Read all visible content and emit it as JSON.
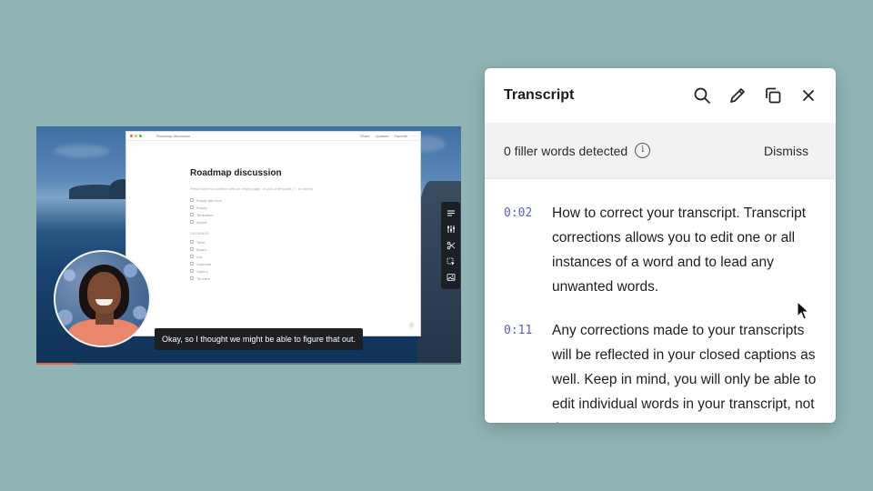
{
  "video": {
    "window": {
      "crumb": "Roadmap discussion",
      "actions": [
        "Share",
        "Updates",
        "Favorite",
        "···"
      ]
    },
    "doc": {
      "title": "Roadmap discussion",
      "hint": "Press Enter to continue with an empty page, or pick a template (↑↓ to select)",
      "options": [
        "Empty with icon",
        "Empty",
        "Templates",
        "Import"
      ],
      "section": "DATABASE",
      "database_items": [
        "Table",
        "Board",
        "List",
        "Calendar",
        "Gallery",
        "Timeline"
      ],
      "help": "?"
    },
    "toolbar_icons": [
      "lines-icon",
      "sliders-icon",
      "scissors-icon",
      "select-icon",
      "image-icon"
    ],
    "caption": "Okay, so I thought we might be able to figure that out.",
    "progress": 0.09
  },
  "transcript": {
    "title": "Transcript",
    "header_icons": [
      "search-icon",
      "pencil-icon",
      "copy-icon",
      "close-icon"
    ],
    "filler": {
      "text": "0 filler words detected",
      "info_icon": "i",
      "dismiss_label": "Dismiss"
    },
    "entries": [
      {
        "time": "0:02",
        "text": "How to correct your transcript. Transcript corrections allows you to edit one or all instances of a word and to lead any unwanted words."
      },
      {
        "time": "0:11",
        "text": "Any corrections made to your transcripts will be reflected in your closed captions as well. Keep in mind, you will only be able to edit individual words in your transcript, not the"
      }
    ]
  },
  "colors": {
    "background": "#8fb4b3",
    "timestamp": "#5a5fc0",
    "progress": "#e8633c"
  }
}
